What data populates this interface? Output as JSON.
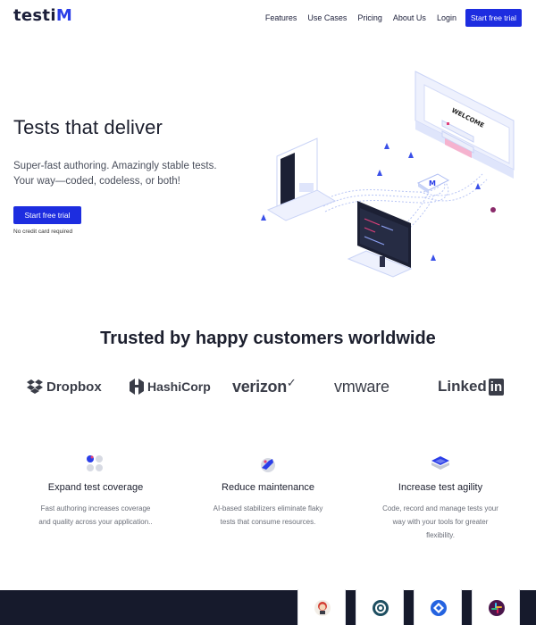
{
  "header": {
    "logo_text": "testi",
    "logo_accent": "M",
    "nav": [
      "Features",
      "Use Cases",
      "Pricing",
      "About Us",
      "Login"
    ],
    "cta": "Start free trial"
  },
  "hero": {
    "title": "Tests that deliver",
    "subtitle_line1": "Super-fast authoring. Amazingly stable tests.",
    "subtitle_line2": "Your way—coded, codeless, or both!",
    "cta": "Start free trial",
    "note": "No credit card required",
    "illustration_label": "WELCOME"
  },
  "customers": {
    "title": "Trusted by happy customers worldwide",
    "logos": [
      "Dropbox",
      "HashiCorp",
      "verizon",
      "vmware",
      "Linked"
    ],
    "linkedin_badge": "in"
  },
  "features": [
    {
      "title": "Expand test coverage",
      "text": "Fast authoring increases coverage and quality across your application..",
      "icon": "coverage-icon"
    },
    {
      "title": "Reduce maintenance",
      "text": "AI-based stabilizers eliminate flaky tests that consume resources.",
      "icon": "maintenance-icon"
    },
    {
      "title": "Increase test agility",
      "text": "Code, record and manage tests your way with your tools for greater flexibility.",
      "icon": "agility-icon"
    }
  ],
  "integrations": [
    "jenkins-icon",
    "circleci-icon",
    "jira-icon",
    "slack-icon"
  ],
  "colors": {
    "brand_blue": "#1d2de0",
    "dark_footer": "#161a2c",
    "text_dark": "#1c1f2e"
  }
}
